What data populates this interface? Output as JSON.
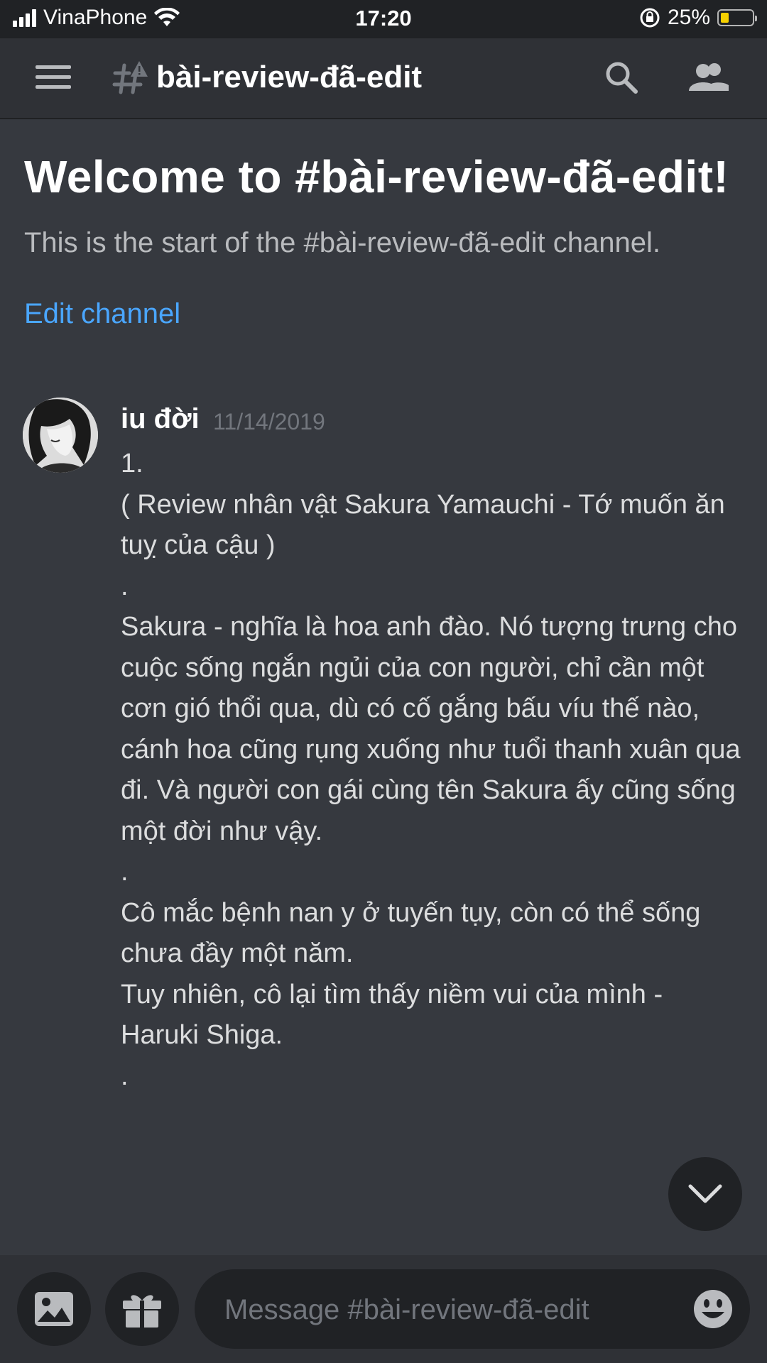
{
  "status_bar": {
    "carrier": "VinaPhone",
    "time": "17:20",
    "battery": "25%",
    "battery_level": 0.25
  },
  "header": {
    "channel_name": "bài-review-đã-edit"
  },
  "welcome": {
    "title": "Welcome to #bài-review-đã-edit!",
    "subtitle": "This is the start of the #bài-review-đã-edit channel.",
    "edit_link": "Edit channel"
  },
  "message": {
    "author": "iu đời",
    "timestamp": "11/14/2019",
    "paragraphs": [
      "1.",
      "( Review nhân vật Sakura Yamauchi - Tớ muốn ăn tuỵ của cậu )",
      "",
      ".",
      "",
      "Sakura - nghĩa là hoa anh đào. Nó tượng trưng cho cuộc sống ngắn ngủi của con người, chỉ cần một cơn gió thổi qua, dù có cố gắng bấu víu thế nào, cánh hoa cũng rụng xuống như tuổi thanh xuân qua đi. Và người con gái cùng tên Sakura ấy cũng sống một đời như vậy.",
      ".",
      "",
      "Cô mắc bệnh nan y ở tuyến tụy, còn có thể sống chưa đầy một năm.",
      "Tuy nhiên, cô lại tìm thấy niềm vui của mình - Haruki Shiga.",
      "."
    ]
  },
  "composer": {
    "placeholder": "Message #bài-review-đã-edit"
  },
  "icons": {
    "menu": "hamburger-icon",
    "channel": "hash-lock-icon",
    "search": "search-icon",
    "members": "members-icon",
    "scroll": "chevron-down-icon",
    "image": "image-icon",
    "gift": "gift-icon",
    "emoji": "emoji-icon"
  },
  "colors": {
    "background": "#36393f",
    "header": "#2f3136",
    "link": "#4aa6ff",
    "input": "#202225"
  }
}
